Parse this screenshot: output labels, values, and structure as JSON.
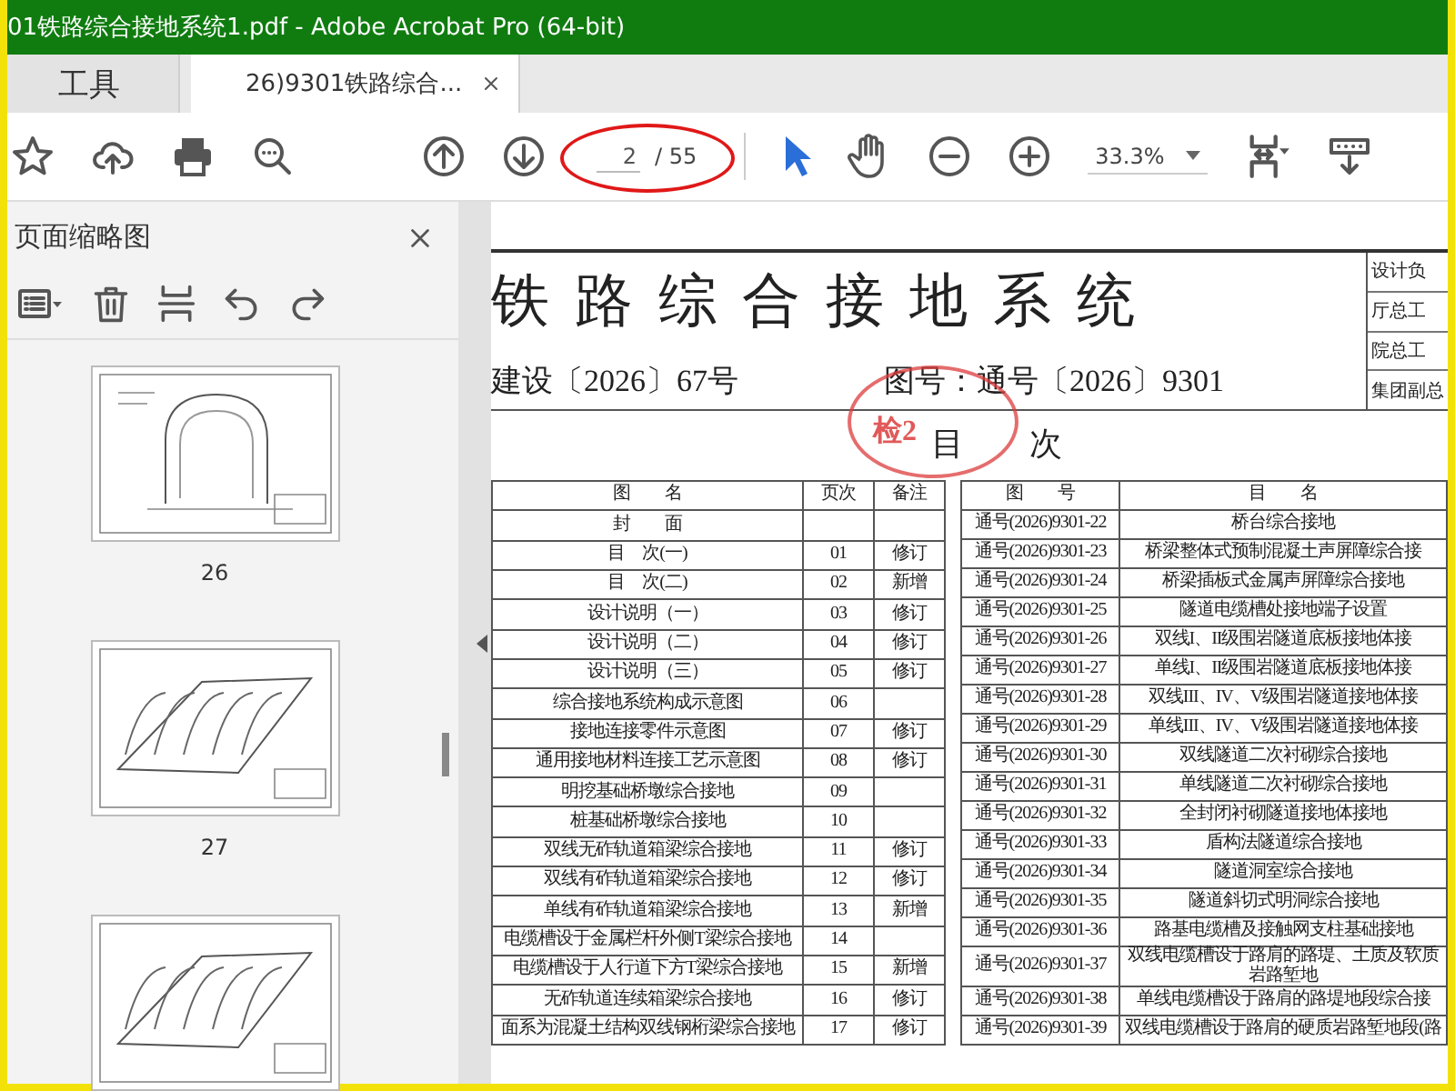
{
  "window": {
    "title": "01铁路综合接地系统1.pdf - Adobe Acrobat Pro (64-bit)"
  },
  "tabs": [
    {
      "label": "工具",
      "selected": false,
      "closable": false
    },
    {
      "label": "26)9301铁路综合...",
      "selected": true,
      "closable": true
    }
  ],
  "page_nav": {
    "current": "2",
    "total": "/ 55"
  },
  "tools": [
    {
      "kind": "select",
      "selected": true
    },
    {
      "kind": "hand",
      "selected": false
    }
  ],
  "zoom": "33.3%",
  "sidebar": {
    "title": "页面缩略图",
    "thumbnails": [
      {
        "label": "26",
        "selected": false
      },
      {
        "label": "27",
        "selected": false
      },
      {
        "selected": false
      }
    ]
  },
  "document": {
    "title": "铁路综合接地系统",
    "approval": "建设〔2026〕67号",
    "drawing_no": "图号：通号〔2026〕9301",
    "signoff": [
      "设计负",
      "厅总工",
      "院总工",
      "集团副总"
    ],
    "stamp": "检2",
    "heading": "目　　次",
    "left_table": {
      "columns": [
        "图　　名",
        "页次",
        "备注"
      ],
      "rows": [
        [
          "封　　面",
          "",
          ""
        ],
        [
          "目　次(一)",
          "01",
          "修订"
        ],
        [
          "目　次(二)",
          "02",
          "新增"
        ],
        [
          "设计说明（一）",
          "03",
          "修订"
        ],
        [
          "设计说明（二）",
          "04",
          "修订"
        ],
        [
          "设计说明（三）",
          "05",
          "修订"
        ],
        [
          "综合接地系统构成示意图",
          "06",
          ""
        ],
        [
          "接地连接零件示意图",
          "07",
          "修订"
        ],
        [
          "通用接地材料连接工艺示意图",
          "08",
          "修订"
        ],
        [
          "明挖基础桥墩综合接地",
          "09",
          ""
        ],
        [
          "桩基础桥墩综合接地",
          "10",
          ""
        ],
        [
          "双线无砟轨道箱梁综合接地",
          "11",
          "修订"
        ],
        [
          "双线有砟轨道箱梁综合接地",
          "12",
          "修订"
        ],
        [
          "单线有砟轨道箱梁综合接地",
          "13",
          "新增"
        ],
        [
          "电缆槽设于金属栏杆外侧T梁综合接地",
          "14",
          ""
        ],
        [
          "电缆槽设于人行道下方T梁综合接地",
          "15",
          "新增"
        ],
        [
          "无砟轨道连续箱梁综合接地",
          "16",
          "修订"
        ],
        [
          "面系为混凝土结构双线钢桁梁综合接地",
          "17",
          "修订"
        ]
      ]
    },
    "right_table": {
      "columns": [
        "图　　号",
        "目　　名"
      ],
      "rows": [
        [
          "通号(2026)9301-22",
          "桥台综合接地"
        ],
        [
          "通号(2026)9301-23",
          "桥梁整体式预制混凝土声屏障综合接"
        ],
        [
          "通号(2026)9301-24",
          "桥梁插板式金属声屏障综合接地"
        ],
        [
          "通号(2026)9301-25",
          "隧道电缆槽处接地端子设置"
        ],
        [
          "通号(2026)9301-26",
          "双线I、II级围岩隧道底板接地体接"
        ],
        [
          "通号(2026)9301-27",
          "单线I、II级围岩隧道底板接地体接"
        ],
        [
          "通号(2026)9301-28",
          "双线III、IV、V级围岩隧道接地体接"
        ],
        [
          "通号(2026)9301-29",
          "单线III、IV、V级围岩隧道接地体接"
        ],
        [
          "通号(2026)9301-30",
          "双线隧道二次衬砌综合接地"
        ],
        [
          "通号(2026)9301-31",
          "单线隧道二次衬砌综合接地"
        ],
        [
          "通号(2026)9301-32",
          "全封闭衬砌隧道接地体接地"
        ],
        [
          "通号(2026)9301-33",
          "盾构法隧道综合接地"
        ],
        [
          "通号(2026)9301-34",
          "隧道洞室综合接地"
        ],
        [
          "通号(2026)9301-35",
          "隧道斜切式明洞综合接地"
        ],
        [
          "通号(2026)9301-36",
          "路基电缆槽及接触网支柱基础接地"
        ],
        [
          "通号(2026)9301-37",
          "双线电缆槽设于路肩的路堤、土质及软质岩路堑地"
        ],
        [
          "通号(2026)9301-38",
          "单线电缆槽设于路肩的路堤地段综合接"
        ],
        [
          "通号(2026)9301-39",
          "双线电缆槽设于路肩的硬质岩路堑地段(路"
        ]
      ]
    }
  }
}
